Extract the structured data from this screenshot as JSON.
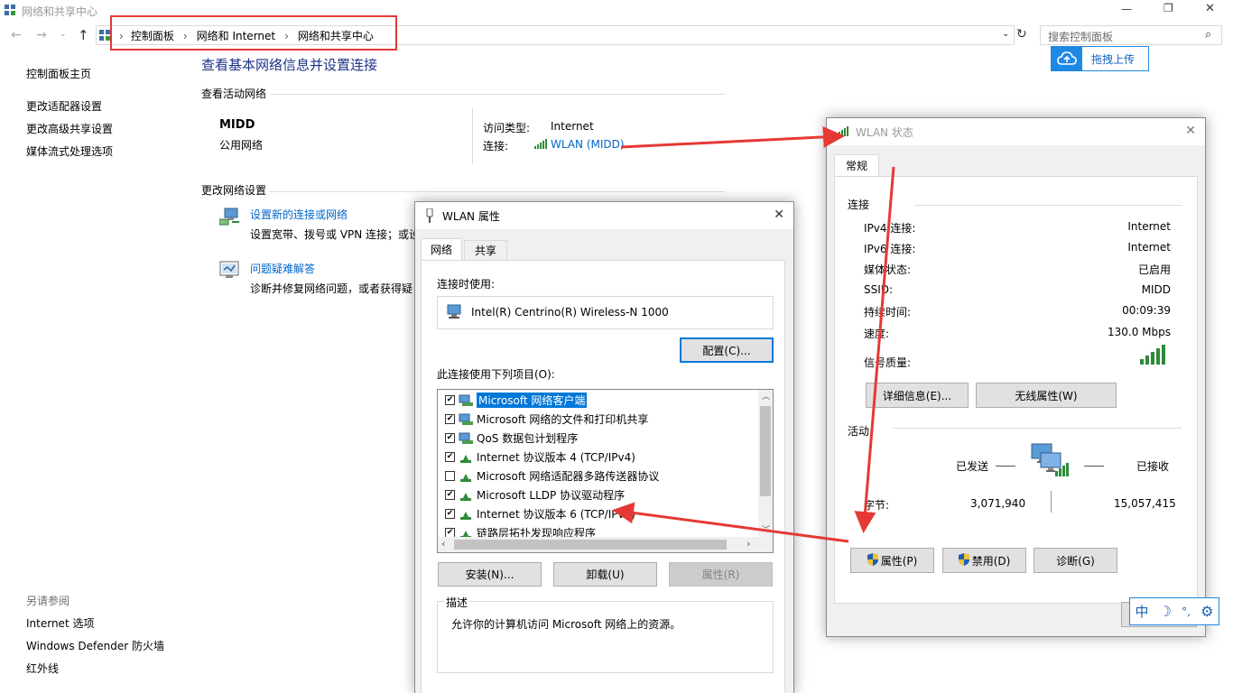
{
  "window": {
    "title": "网络和共享中心",
    "controls": {
      "minimize": "—",
      "maximize": "❐",
      "close": "✕"
    }
  },
  "address": {
    "breadcrumb": [
      "控制面板",
      "网络和 Internet",
      "网络和共享中心"
    ],
    "search_placeholder": "搜索控制面板"
  },
  "upload_button": "拖拽上传",
  "sidebar": {
    "items": [
      "控制面板主页",
      "更改适配器设置",
      "更改高级共享设置",
      "媒体流式处理选项"
    ],
    "see_also_title": "另请参阅",
    "see_also": [
      "Internet 选项",
      "Windows Defender 防火墙",
      "红外线"
    ]
  },
  "main": {
    "title": "查看基本网络信息并设置连接",
    "active_networks_title": "查看活动网络",
    "network_name": "MIDD",
    "network_type": "公用网络",
    "access_type_label": "访问类型:",
    "access_type_value": "Internet",
    "connection_label": "连接:",
    "connection_value": "WLAN (MIDD)",
    "change_settings_title": "更改网络设置",
    "actions": [
      {
        "title": "设置新的连接或网络",
        "desc": "设置宽带、拨号或 VPN 连接；或设"
      },
      {
        "title": "问题疑难解答",
        "desc": "诊断并修复网络问题，或者获得疑"
      }
    ]
  },
  "props": {
    "title": "WLAN 属性",
    "tabs": [
      "网络",
      "共享"
    ],
    "connect_using_label": "连接时使用:",
    "adapter": "Intel(R) Centrino(R) Wireless-N 1000",
    "configure_button": "配置(C)...",
    "items_label": "此连接使用下列项目(O):",
    "items": [
      {
        "label": "Microsoft 网络客户端",
        "checked": true,
        "selected": true
      },
      {
        "label": "Microsoft 网络的文件和打印机共享",
        "checked": true,
        "selected": false
      },
      {
        "label": "QoS 数据包计划程序",
        "checked": true,
        "selected": false
      },
      {
        "label": "Internet 协议版本 4 (TCP/IPv4)",
        "checked": true,
        "selected": false
      },
      {
        "label": "Microsoft 网络适配器多路传送器协议",
        "checked": false,
        "selected": false
      },
      {
        "label": "Microsoft LLDP 协议驱动程序",
        "checked": true,
        "selected": false
      },
      {
        "label": "Internet 协议版本 6 (TCP/IPv6)",
        "checked": true,
        "selected": false
      },
      {
        "label": "链路层拓扑发现响应程序",
        "checked": true,
        "selected": false
      }
    ],
    "install_button": "安装(N)...",
    "uninstall_button": "卸载(U)",
    "properties_button": "属性(R)",
    "description_title": "描述",
    "description": "允许你的计算机访问 Microsoft 网络上的资源。"
  },
  "status": {
    "title": "WLAN 状态",
    "tab": "常规",
    "connection_title": "连接",
    "rows": [
      {
        "label": "IPv4 连接:",
        "value": "Internet"
      },
      {
        "label": "IPv6 连接:",
        "value": "Internet"
      },
      {
        "label": "媒体状态:",
        "value": "已启用"
      },
      {
        "label": "SSID:",
        "value": "MIDD"
      },
      {
        "label": "持续时间:",
        "value": "00:09:39"
      },
      {
        "label": "速度:",
        "value": "130.0 Mbps"
      }
    ],
    "signal_label": "信号质量:",
    "details_button": "详细信息(E)...",
    "wireless_props_button": "无线属性(W)",
    "activity_title": "活动",
    "sent_label": "已发送",
    "received_label": "已接收",
    "bytes_label": "字节:",
    "bytes_sent": "3,071,940",
    "bytes_received": "15,057,415",
    "properties_button": "属性(P)",
    "disable_button": "禁用(D)",
    "diagnose_button": "诊断(G)"
  },
  "ime": {
    "mode": "中",
    "moon": "☽",
    "punct": "°,",
    "gear": "⚙"
  },
  "colors": {
    "link": "#0066cc",
    "selection": "#0078d7",
    "annotation": "#e53935",
    "signal": "#2e8b3a"
  }
}
